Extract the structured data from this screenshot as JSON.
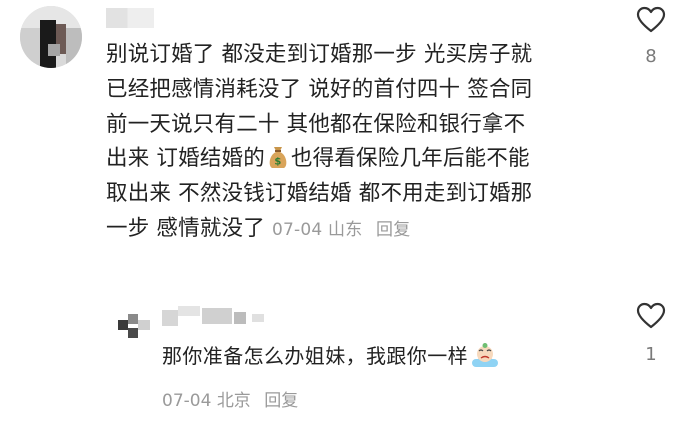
{
  "comment": {
    "lines": [
      "别说订婚了 都没走到订婚那一步 光买房子就",
      "已经把感情消耗没了 说好的首付四十 签合同",
      "前一天说只有二十 其他都在保险和银行拿不",
      "出来 订婚结婚的",
      "也得看保险几年后能不能",
      "取出来 不然没钱订婚结婚 都不用走到订婚那",
      "一步 感情就没了"
    ],
    "meta_date": "07-04",
    "meta_location": "山东",
    "reply_label": "回复",
    "like_count": "8",
    "emoji_icon": "money-bag-icon"
  },
  "reply": {
    "text": "那你准备怎么办姐妹，我跟你一样",
    "emoji_icon": "crying-face-icon",
    "meta_date": "07-04",
    "meta_location": "北京",
    "reply_label": "回复",
    "like_count": "1"
  },
  "colors": {
    "text": "#222222",
    "meta": "#9a9a9a",
    "icon_stroke": "#333333"
  }
}
